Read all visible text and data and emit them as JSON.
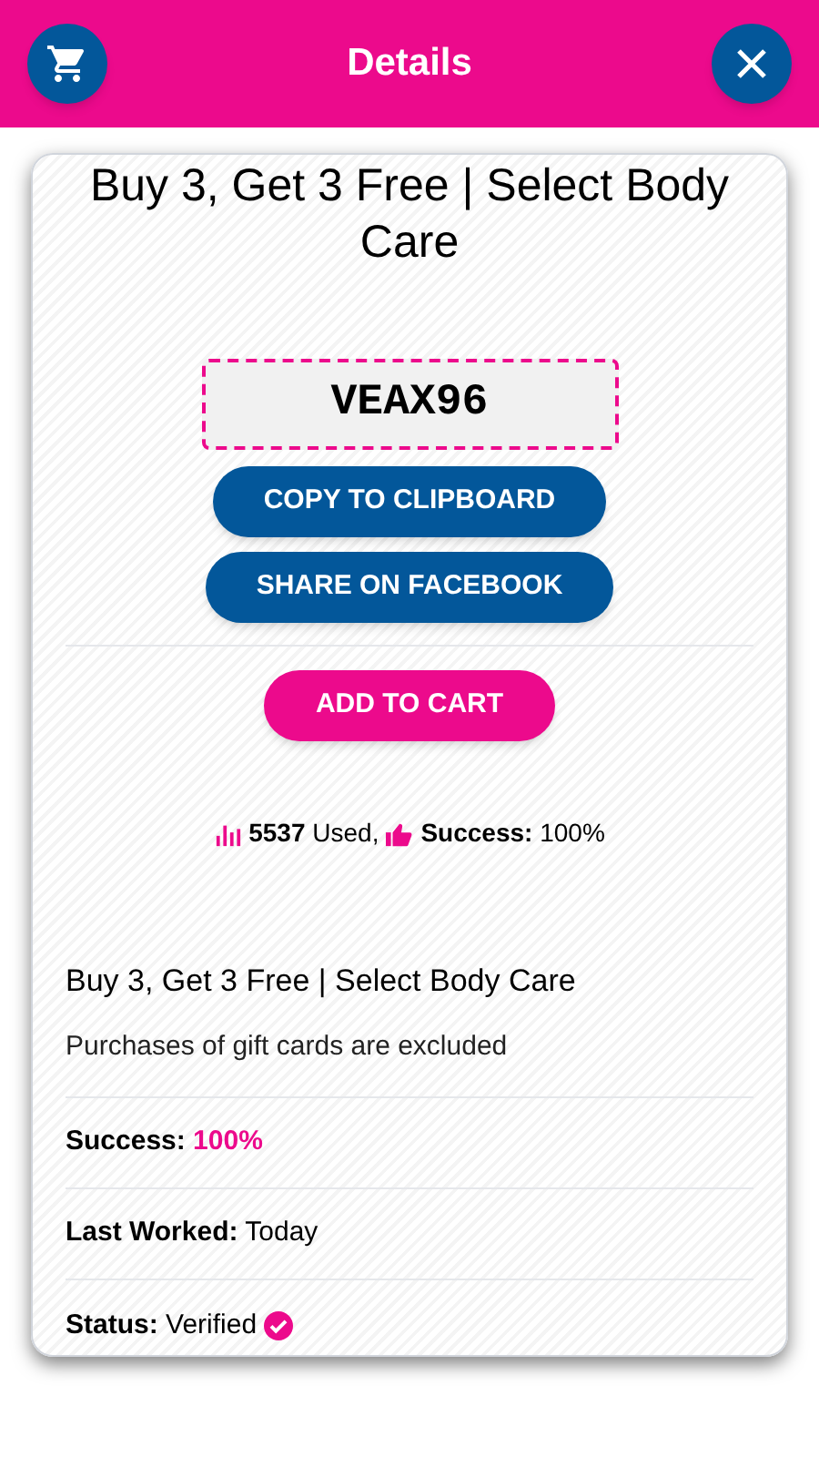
{
  "header": {
    "title": "Details"
  },
  "card": {
    "title": "Buy 3, Get 3 Free | Select Body Care",
    "code": "VEAX96",
    "buttons": [
      {
        "label": "COPY TO CLIPBOARD",
        "kind": "secondary"
      },
      {
        "label": "SHARE ON FACEBOOK",
        "kind": "secondary"
      },
      {
        "label": "ADD TO CART",
        "kind": "primary"
      }
    ],
    "stats": [
      {
        "kind": "used",
        "text": "**5537** Used,"
      },
      {
        "kind": "success",
        "text": "**Success:** 100%"
      }
    ],
    "offer_title": "Buy 3, Get 3 Free | Select Body Care",
    "offer_note": "Purchases of gift cards are excluded",
    "details": [
      {
        "label": "Success:",
        "value": "100%",
        "highlight": true,
        "verified": false
      },
      {
        "label": "Last Worked:",
        "value": "Today",
        "highlight": false,
        "verified": false
      },
      {
        "label": "Status:",
        "value": "Verified",
        "highlight": false,
        "verified": true
      }
    ]
  }
}
